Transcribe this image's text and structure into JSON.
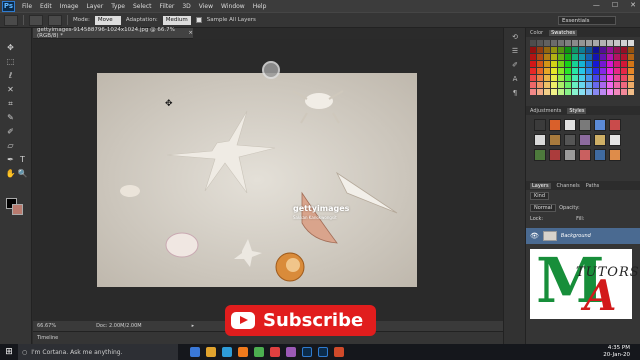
{
  "menubar": {
    "logo": "Ps",
    "items": [
      "File",
      "Edit",
      "Image",
      "Layer",
      "Type",
      "Select",
      "Filter",
      "3D",
      "View",
      "Window",
      "Help"
    ],
    "window_controls": [
      "—",
      "☐",
      "✕"
    ]
  },
  "options": {
    "mode_label": "Mode:",
    "mode_value": "Move",
    "adaptation_label": "Adaptation:",
    "adaptation_value": "Medium",
    "sample_all_layers": "Sample All Layers",
    "workspace": "Essentials"
  },
  "document": {
    "tab_title": "gettyimages-914588796-1024x1024.jpg @ 66.7% (RGB/8) *",
    "tab_close": "×",
    "watermark_brand": "gettyimages",
    "watermark_credit": "Sakkan Kanokwongsit"
  },
  "status": {
    "zoom": "66.67%",
    "doc_size": "Doc: 2.00M/2.00M",
    "arrow": "▸"
  },
  "timeline": {
    "label": "Timeline"
  },
  "panels": {
    "color_tabs": [
      "Color",
      "Swatches"
    ],
    "adjust_tabs": [
      "Adjustments",
      "Styles"
    ],
    "layers_tabs": [
      "Layers",
      "Channels",
      "Paths"
    ],
    "kind_label": "Kind",
    "blend_mode": "Normal",
    "opacity_label": "Opacity:",
    "lock_label": "Lock:",
    "fill_label": "Fill:",
    "layer_name": "Background",
    "eye": "👁"
  },
  "logo": {
    "letter_m": "M",
    "tutors": "TUTORS",
    "letter_a": "A"
  },
  "subscribe": {
    "label": "Subscribe"
  },
  "taskbar": {
    "search_placeholder": "I'm Cortana. Ask me anything.",
    "time": "4:35 PM",
    "date": "20-Jan-20",
    "tray_lang": "ENG"
  },
  "colors": {
    "accent": "#4a6a91",
    "subscribe_red": "#e11d1d",
    "logo_green": "#178e3a",
    "logo_red": "#d21a1a"
  }
}
